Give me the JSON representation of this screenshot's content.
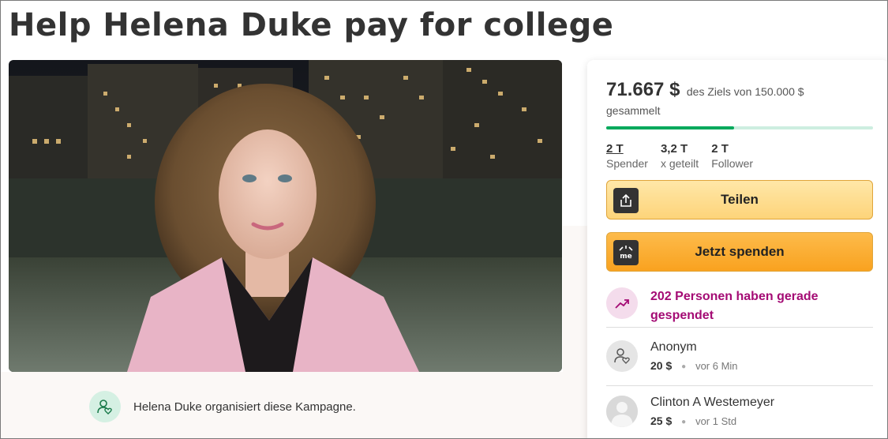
{
  "page": {
    "title": "Help Helena Duke pay for college"
  },
  "organizer": {
    "text": "Helena Duke organisiert diese Kampagne.",
    "icon": "person-heart-icon"
  },
  "donation_card": {
    "raised": "71.667 $",
    "goal_text": "des Ziels von 150.000 $",
    "collected_label": "gesammelt",
    "progress_fraction": 0.478,
    "stats": [
      {
        "value": "2 T",
        "label": "Spender"
      },
      {
        "value": "3,2 T",
        "label": "x geteilt"
      },
      {
        "value": "2 T",
        "label": "Follower"
      }
    ],
    "share_button": "Teilen",
    "donate_button": "Jetzt spenden",
    "trend_text": "202 Personen haben gerade gespendet",
    "donors": [
      {
        "name": "Anonym",
        "amount": "20 $",
        "time": "vor 6 Min"
      },
      {
        "name": "Clinton A Westemeyer",
        "amount": "25 $",
        "time": "vor 1 Std"
      }
    ]
  },
  "colors": {
    "progress_fill": "#02a95c",
    "progress_track": "#cdeee0",
    "trend_text": "#a40b74",
    "donate_button": "#f9a21f",
    "share_button": "#fdd47a"
  }
}
